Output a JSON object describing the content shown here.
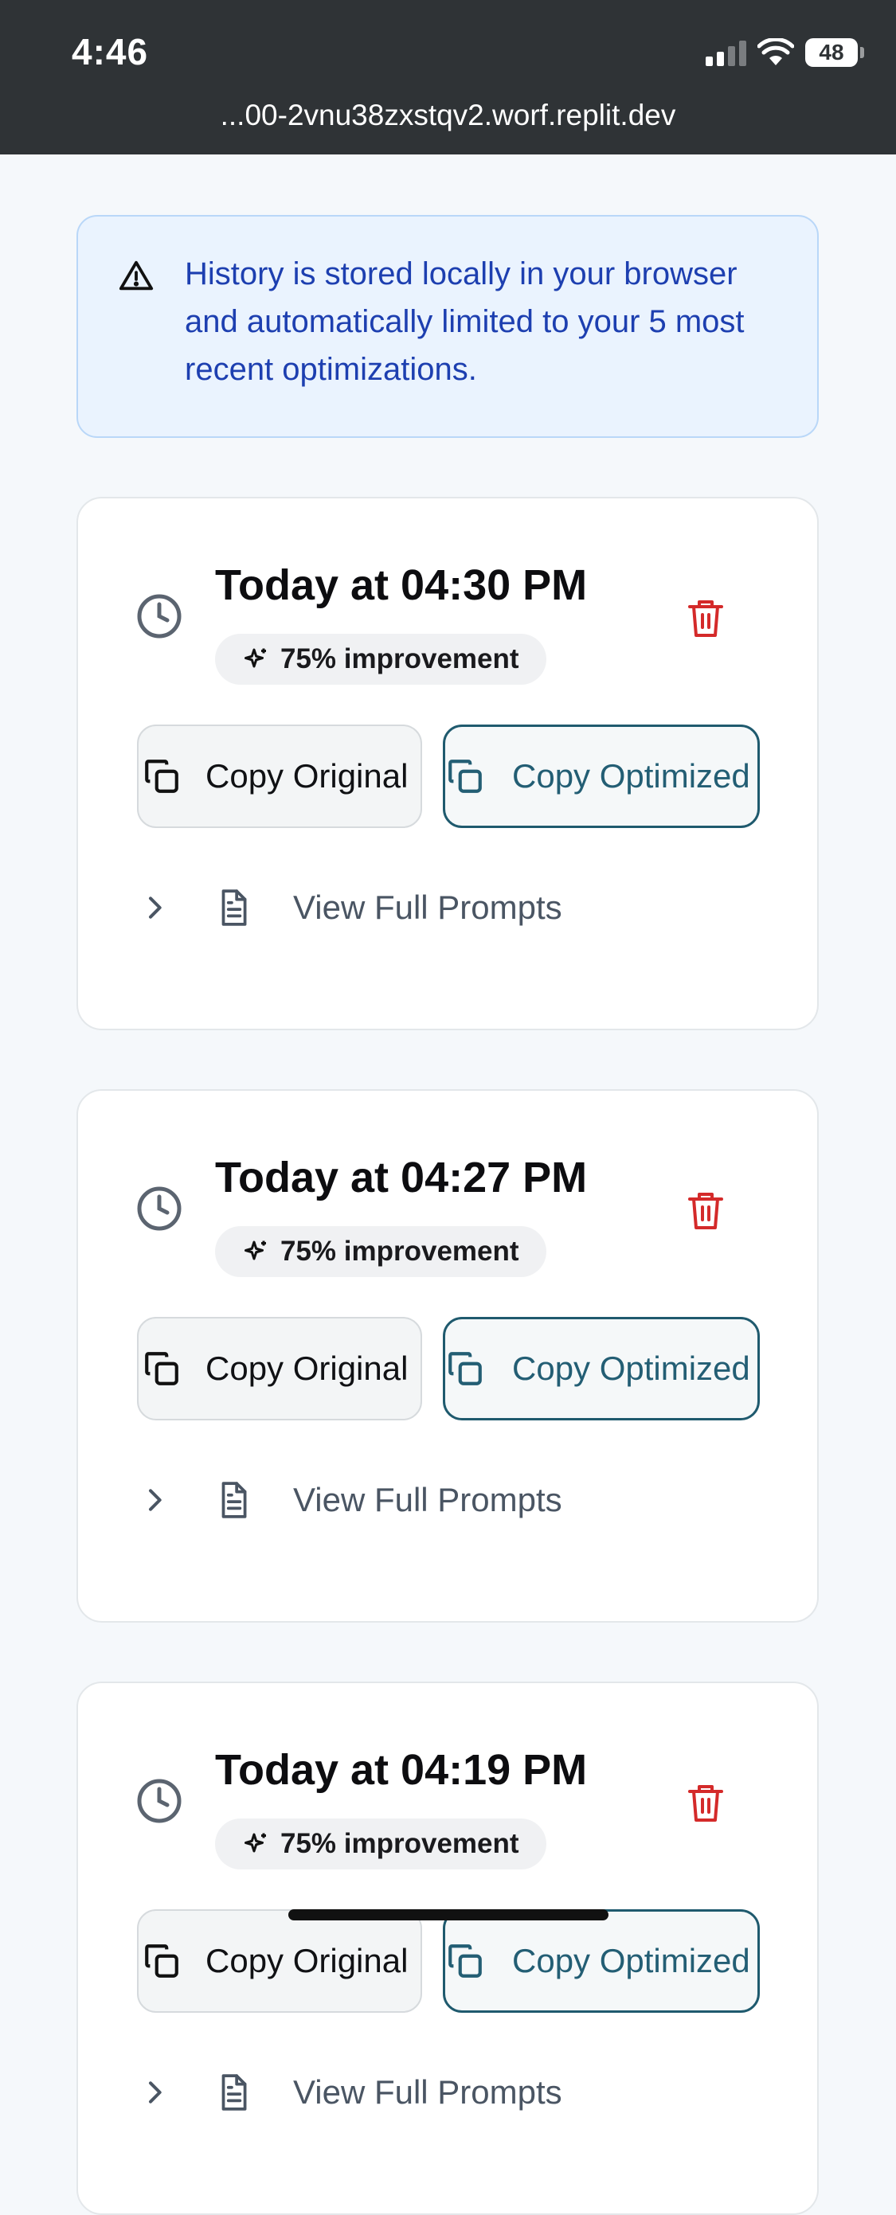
{
  "status_bar": {
    "time": "4:46",
    "battery": "48"
  },
  "browser": {
    "url": "...00-2vnu38zxstqv2.worf.replit.dev"
  },
  "notice": {
    "icon": "warning-triangle-icon",
    "text": "History is stored locally in your browser and automatically limited to your 5 most recent optimizations."
  },
  "history": [
    {
      "title": "Today at 04:30 PM",
      "badge": "75% improvement",
      "copy_original": "Copy Original",
      "copy_optimized": "Copy Optimized",
      "view_prompts": "View Full Prompts"
    },
    {
      "title": "Today at 04:27 PM",
      "badge": "75% improvement",
      "copy_original": "Copy Original",
      "copy_optimized": "Copy Optimized",
      "view_prompts": "View Full Prompts"
    },
    {
      "title": "Today at 04:19 PM",
      "badge": "75% improvement",
      "copy_original": "Copy Original",
      "copy_optimized": "Copy Optimized",
      "view_prompts": "View Full Prompts"
    }
  ],
  "colors": {
    "notice_text": "#1d3fb0",
    "delete_red": "#d42a2a",
    "optimized_accent": "#1f5a6e"
  }
}
